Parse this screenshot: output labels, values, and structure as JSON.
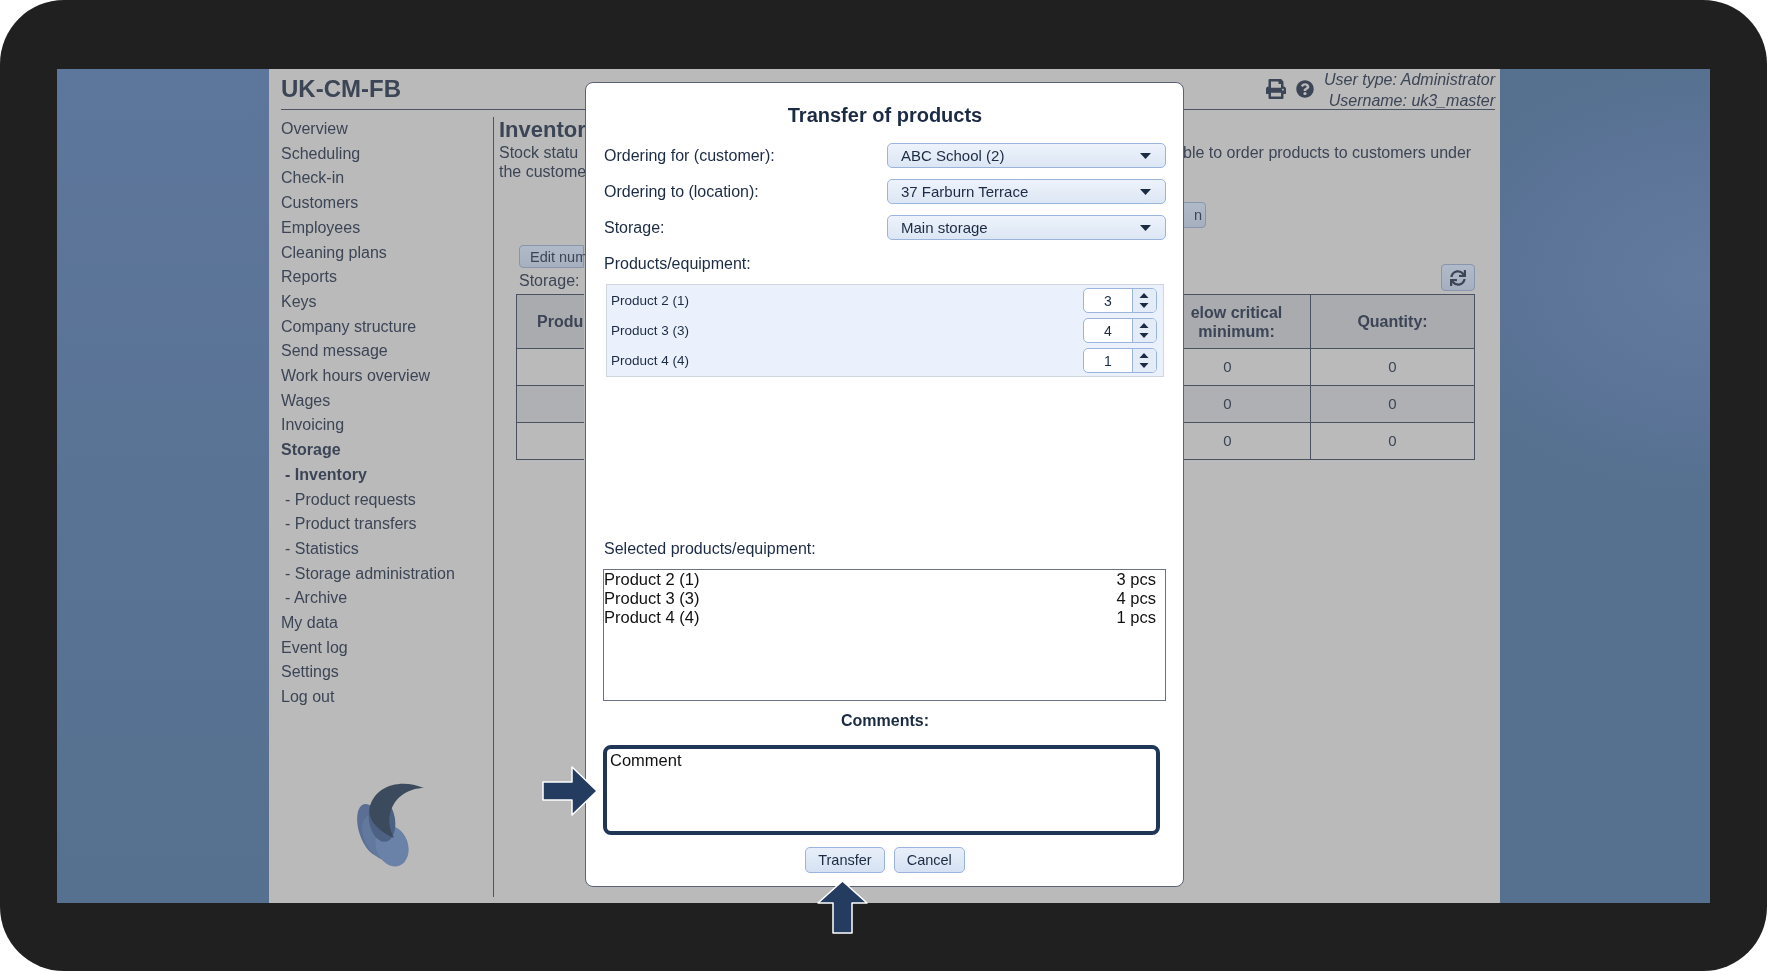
{
  "header": {
    "title": "UK-CM-FB",
    "user_type": "User type: Administrator",
    "username": "Username: uk3_master"
  },
  "sidebar": {
    "items": [
      {
        "label": "Overview",
        "selected": false
      },
      {
        "label": "Scheduling",
        "selected": false
      },
      {
        "label": "Check-in",
        "selected": false
      },
      {
        "label": "Customers",
        "selected": false
      },
      {
        "label": "Employees",
        "selected": false
      },
      {
        "label": "Cleaning plans",
        "selected": false
      },
      {
        "label": "Reports",
        "selected": false
      },
      {
        "label": "Keys",
        "selected": false
      },
      {
        "label": "Company structure",
        "selected": false
      },
      {
        "label": "Send message",
        "selected": false
      },
      {
        "label": "Work hours overview",
        "selected": false
      },
      {
        "label": "Wages",
        "selected": false
      },
      {
        "label": "Invoicing",
        "selected": false
      },
      {
        "label": "Storage",
        "selected": true,
        "children": [
          {
            "label": "- Inventory",
            "selected": true
          },
          {
            "label": "- Product requests",
            "selected": false
          },
          {
            "label": "- Product transfers",
            "selected": false
          },
          {
            "label": "- Statistics",
            "selected": false
          },
          {
            "label": "- Storage administration",
            "selected": false
          },
          {
            "label": "- Archive",
            "selected": false
          }
        ]
      },
      {
        "label": "My data",
        "selected": false
      },
      {
        "label": "Event log",
        "selected": false
      },
      {
        "label": "Settings",
        "selected": false
      },
      {
        "label": "Log out",
        "selected": false
      }
    ]
  },
  "main": {
    "title": "Inventor",
    "description_left": [
      "Stock statu",
      "the custome"
    ],
    "description_right": "ble to order products to customers under",
    "edit_button": "Edit num",
    "right_button": "n",
    "storage_label": "Storage:",
    "table": {
      "left_header": "Produ",
      "right_headers": [
        "elow critical minimum:",
        "Quantity:"
      ],
      "rows": [
        {
          "cells": [
            "0",
            "0"
          ]
        },
        {
          "cells": [
            "0",
            "0"
          ]
        },
        {
          "cells": [
            "0",
            "0"
          ]
        }
      ]
    }
  },
  "dialog": {
    "title": "Transfer of products",
    "fields": [
      {
        "label": "Ordering for (customer):",
        "value": "ABC School (2)"
      },
      {
        "label": "Ordering to (location):",
        "value": "37 Farburn Terrace"
      },
      {
        "label": "Storage:",
        "value": "Main storage"
      }
    ],
    "products_label": "Products/equipment:",
    "products": [
      {
        "name": "Product 2 (1)",
        "quantity": "3"
      },
      {
        "name": "Product 3 (3)",
        "quantity": "4"
      },
      {
        "name": "Product 4 (4)",
        "quantity": "1"
      }
    ],
    "selected_label": "Selected products/equipment:",
    "selected_items": [
      {
        "name": "Product 2 (1)",
        "quantity": "3 pcs"
      },
      {
        "name": "Product 3 (3)",
        "quantity": "4 pcs"
      },
      {
        "name": "Product 4 (4)",
        "quantity": "1 pcs"
      }
    ],
    "comments_label": "Comments:",
    "comment": {
      "value": "Comment",
      "highlighted": true
    },
    "buttons": [
      "Transfer",
      "Cancel"
    ]
  }
}
